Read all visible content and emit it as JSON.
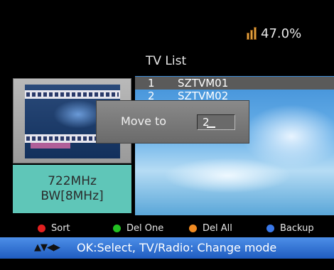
{
  "status": {
    "icon": "signal-strength-icon",
    "percent": "47.0%"
  },
  "title": "TV List",
  "preview": {
    "frequency": "722MHz",
    "bandwidth": "BW[8MHz]"
  },
  "channels": [
    {
      "number": "1",
      "name": "SZTVM01"
    },
    {
      "number": "2",
      "name": "SZTVM02"
    }
  ],
  "dialog": {
    "label": "Move to",
    "value": "2"
  },
  "keys": [
    {
      "label": "Sort",
      "color": "#e22020"
    },
    {
      "label": "Del One",
      "color": "#22c022"
    },
    {
      "label": "Del All",
      "color": "#f08a22"
    },
    {
      "label": "Backup",
      "color": "#3a78e8"
    }
  ],
  "help": {
    "arrows": "▲▼◀▶",
    "text": "OK:Select, TV/Radio: Change mode"
  }
}
